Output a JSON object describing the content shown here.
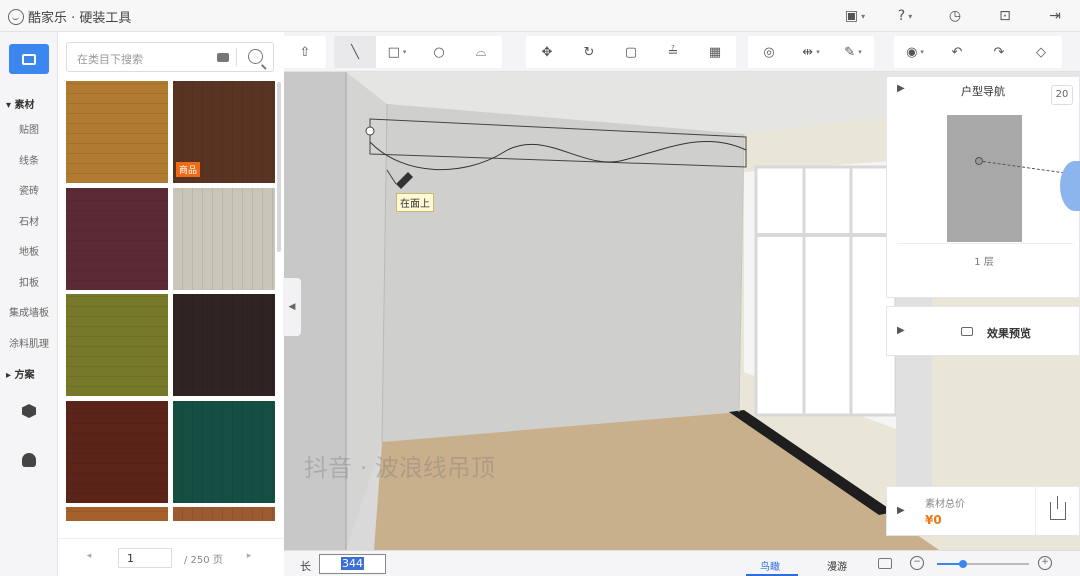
{
  "app": {
    "title": "酷家乐 · 硬装工具"
  },
  "top_actions": [
    {
      "icon": "save-icon",
      "glyph": "▣",
      "has_chevron": true
    },
    {
      "icon": "help-icon",
      "glyph": "?",
      "has_chevron": true
    },
    {
      "icon": "history-icon",
      "glyph": "◷",
      "has_chevron": false
    },
    {
      "icon": "save-file-icon",
      "glyph": "⊡",
      "has_chevron": false
    },
    {
      "icon": "exit-icon",
      "glyph": "⇥",
      "has_chevron": false
    }
  ],
  "leftnav": {
    "section_material": "素材",
    "items": [
      "贴图",
      "线条",
      "瓷砖",
      "石材",
      "地板",
      "扣板",
      "集成墙板",
      "涂料肌理"
    ],
    "section_plan": "方案"
  },
  "catalog": {
    "search_placeholder": "在类目下搜索",
    "tiles": [
      {
        "name": "wood-oak",
        "color": "#b07a30",
        "badge": ""
      },
      {
        "name": "wood-dark",
        "color": "#5a3422",
        "badge": "商品"
      },
      {
        "name": "marble-purple",
        "color": "#5b2a35",
        "badge": ""
      },
      {
        "name": "wood-grey",
        "color": "#c9c5b8",
        "badge": ""
      },
      {
        "name": "stone-green",
        "color": "#76782a",
        "badge": ""
      },
      {
        "name": "granite-dark",
        "color": "#2f2323",
        "badge": ""
      },
      {
        "name": "marble-red",
        "color": "#5a2418",
        "badge": ""
      },
      {
        "name": "stone-teal",
        "color": "#154e43",
        "badge": ""
      },
      {
        "name": "wood-orange",
        "color": "#a5602c",
        "badge": ""
      },
      {
        "name": "wood-brown",
        "color": "#9b5b2e",
        "badge": ""
      }
    ],
    "pager": {
      "current": "1",
      "total": "/ 250 页"
    }
  },
  "toolbar": {
    "groups": [
      [
        {
          "icon": "upload-icon",
          "glyph": "⇧"
        }
      ],
      [
        {
          "icon": "line-tool-icon",
          "glyph": "╲",
          "active": true
        },
        {
          "icon": "rectangle-tool-icon",
          "glyph": "□",
          "chevron": true
        },
        {
          "icon": "circle-tool-icon",
          "glyph": "○"
        },
        {
          "icon": "arc-tool-icon",
          "glyph": "⌓"
        }
      ],
      [
        {
          "icon": "move-tool-icon",
          "glyph": "✥"
        },
        {
          "icon": "rotate-tool-icon",
          "glyph": "↻"
        },
        {
          "icon": "frame-tool-icon",
          "glyph": "▢"
        },
        {
          "icon": "level-tool-icon",
          "glyph": "≟"
        },
        {
          "icon": "texture-tool-icon",
          "glyph": "▦"
        }
      ],
      [
        {
          "icon": "measure-tool-icon",
          "glyph": "◎"
        },
        {
          "icon": "align-tool-icon",
          "glyph": "⇹",
          "chevron": true
        },
        {
          "icon": "brush-tool-icon",
          "glyph": "✎",
          "chevron": true
        }
      ],
      [
        {
          "icon": "view-toggle-icon",
          "glyph": "◉",
          "chevron": true
        },
        {
          "icon": "undo-icon",
          "glyph": "↶"
        },
        {
          "icon": "redo-icon",
          "glyph": "↷"
        },
        {
          "icon": "eraser-icon",
          "glyph": "◇"
        }
      ]
    ]
  },
  "viewport": {
    "tooltip": "在面上",
    "watermark": "抖音 · 波浪线吊顶"
  },
  "nav_panel": {
    "title": "户型导航",
    "scale": "20",
    "floor": "1 层"
  },
  "preview_panel": {
    "title": "效果预览"
  },
  "price_panel": {
    "label": "素材总价",
    "value": "¥0"
  },
  "statusbar": {
    "length_label": "长",
    "length_value": "344",
    "view_birdseye": "鸟瞰",
    "view_roam": "漫游"
  }
}
